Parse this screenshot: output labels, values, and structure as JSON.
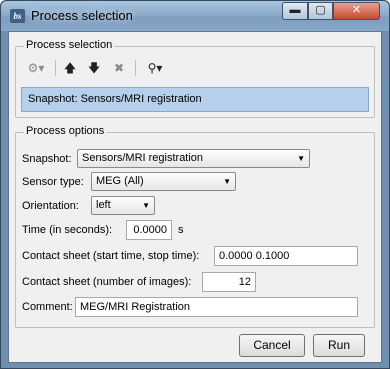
{
  "window": {
    "title": "Process selection",
    "app_icon": "bs"
  },
  "title_buttons": {
    "minimize": "▬",
    "maximize": "▢",
    "close": "✕"
  },
  "process_selection": {
    "group_title": "Process selection",
    "toolbar": {
      "gear": "⚙▾",
      "up": "🡅",
      "down": "🡇",
      "delete": "✖",
      "tree": "⚲▾"
    },
    "selected_item": "Snapshot: Sensors/MRI registration"
  },
  "process_options": {
    "group_title": "Process options",
    "snapshot": {
      "label": "Snapshot:",
      "value": "Sensors/MRI registration"
    },
    "sensor_type": {
      "label": "Sensor type:",
      "value": "MEG (All)"
    },
    "orientation": {
      "label": "Orientation:",
      "value": "left"
    },
    "time": {
      "label": "Time (in seconds):",
      "value": "0.0000",
      "unit": "s"
    },
    "contact_times": {
      "label": "Contact sheet (start time, stop time):",
      "value": "0.0000 0.1000"
    },
    "contact_count": {
      "label": "Contact sheet (number of images):",
      "value": "12"
    },
    "comment": {
      "label": "Comment:",
      "value": "MEG/MRI Registration"
    }
  },
  "buttons": {
    "cancel": "Cancel",
    "run": "Run"
  }
}
